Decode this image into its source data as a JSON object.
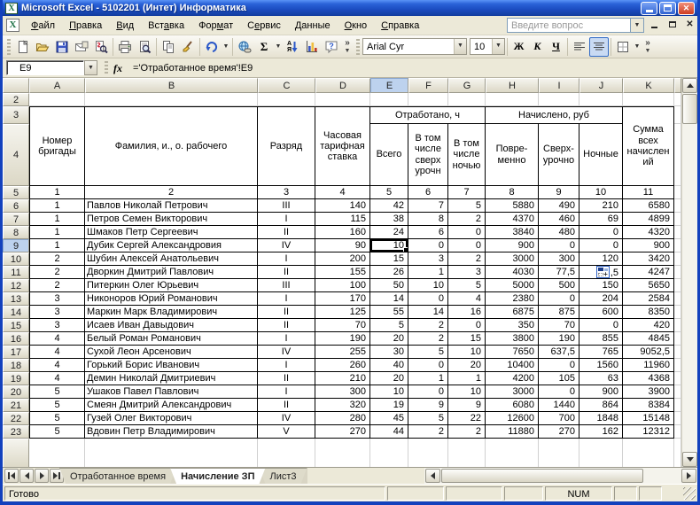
{
  "window": {
    "title": "Microsoft Excel - 5102201 (Интет) Информатика"
  },
  "menu": {
    "items": [
      {
        "label": "Файл",
        "underline": 0
      },
      {
        "label": "Правка",
        "underline": 0
      },
      {
        "label": "Вид",
        "underline": 0
      },
      {
        "label": "Вставка",
        "underline": 3
      },
      {
        "label": "Формат",
        "underline": 3
      },
      {
        "label": "Сервис",
        "underline": 1
      },
      {
        "label": "Данные",
        "underline": 0
      },
      {
        "label": "Окно",
        "underline": 0
      },
      {
        "label": "Справка",
        "underline": 0
      }
    ],
    "question_placeholder": "Введите вопрос"
  },
  "toolbar": {
    "font_name": "Arial Cyr",
    "font_size": "10",
    "bold_label": "Ж",
    "italic_label": "К",
    "underline_label": "Ч",
    "autosum_label": "Σ",
    "sort_top": "А",
    "sort_bottom": "Я",
    "help_label": "?"
  },
  "formula_bar": {
    "name_box": "E9",
    "fx_label": "fx",
    "formula": "='Отработанное время'!E9"
  },
  "sheet": {
    "columns": [
      "A",
      "B",
      "C",
      "D",
      "E",
      "F",
      "G",
      "H",
      "I",
      "J",
      "K"
    ],
    "selected_column": "E",
    "selected_row_header": 9,
    "active_cell": {
      "row": 9,
      "col_index": 4
    },
    "leading_row_numbers": [
      "2",
      "3",
      "4",
      "5"
    ],
    "header": {
      "brigade": "Номер бригады",
      "name": "Фамилия, и., о. рабочего",
      "razryad": "Разряд",
      "rate": "Часовая тарифная ставка",
      "worked_group": "Отработано, ч",
      "worked_total": "Всего",
      "worked_overtime": "В том числе сверх урочн",
      "worked_night": "В том числе ночью",
      "accrued_group": "Начислено, руб",
      "accrued_time": "Повре- менно",
      "accrued_overtime": "Сверх- урочно",
      "accrued_night": "Ночные",
      "total": "Сумма всех начислен ий"
    },
    "numbering_row": [
      "1",
      "2",
      "3",
      "4",
      "5",
      "6",
      "7",
      "8",
      "9",
      "10",
      "11"
    ],
    "rows": [
      {
        "n": 6,
        "c": [
          "1",
          "Павлов Николай Петрович",
          "III",
          "140",
          "42",
          "7",
          "5",
          "5880",
          "490",
          "210",
          "6580"
        ]
      },
      {
        "n": 7,
        "c": [
          "1",
          "Петров Семен Викторович",
          "I",
          "115",
          "38",
          "8",
          "2",
          "4370",
          "460",
          "69",
          "4899"
        ]
      },
      {
        "n": 8,
        "c": [
          "1",
          "Шмаков Петр Сергеевич",
          "II",
          "160",
          "24",
          "6",
          "0",
          "3840",
          "480",
          "0",
          "4320"
        ]
      },
      {
        "n": 9,
        "c": [
          "1",
          "Дубик Сергей Александровия",
          "IV",
          "90",
          "10",
          "0",
          "0",
          "900",
          "0",
          "0",
          "900"
        ]
      },
      {
        "n": 10,
        "c": [
          "2",
          "Шубин Алексей Анатольевич",
          "I",
          "200",
          "15",
          "3",
          "2",
          "3000",
          "300",
          "120",
          "3420"
        ]
      },
      {
        "n": 11,
        "c": [
          "2",
          "Дворкин Дмитрий Павлович",
          "II",
          "155",
          "26",
          "1",
          "3",
          "4030",
          "77,5",
          ",5",
          "4247"
        ]
      },
      {
        "n": 12,
        "c": [
          "2",
          "Питеркин Олег Юрьевич",
          "III",
          "100",
          "50",
          "10",
          "5",
          "5000",
          "500",
          "150",
          "5650"
        ]
      },
      {
        "n": 13,
        "c": [
          "3",
          "Никоноров Юрий Романович",
          "I",
          "170",
          "14",
          "0",
          "4",
          "2380",
          "0",
          "204",
          "2584"
        ]
      },
      {
        "n": 14,
        "c": [
          "3",
          "Маркин Марк Владимирович",
          "II",
          "125",
          "55",
          "14",
          "16",
          "6875",
          "875",
          "600",
          "8350"
        ]
      },
      {
        "n": 15,
        "c": [
          "3",
          "Исаев Иван Давыдович",
          "II",
          "70",
          "5",
          "2",
          "0",
          "350",
          "70",
          "0",
          "420"
        ]
      },
      {
        "n": 16,
        "c": [
          "4",
          "Белый Роман Романович",
          "I",
          "190",
          "20",
          "2",
          "15",
          "3800",
          "190",
          "855",
          "4845"
        ]
      },
      {
        "n": 17,
        "c": [
          "4",
          "Сухой Леон Арсенович",
          "IV",
          "255",
          "30",
          "5",
          "10",
          "7650",
          "637,5",
          "765",
          "9052,5"
        ]
      },
      {
        "n": 18,
        "c": [
          "4",
          "Горький Борис Иванович",
          "I",
          "260",
          "40",
          "0",
          "20",
          "10400",
          "0",
          "1560",
          "11960"
        ]
      },
      {
        "n": 19,
        "c": [
          "4",
          "Демин Николай Дмитриевич",
          "II",
          "210",
          "20",
          "1",
          "1",
          "4200",
          "105",
          "63",
          "4368"
        ]
      },
      {
        "n": 20,
        "c": [
          "5",
          "Ушаков Павел Павлович",
          "I",
          "300",
          "10",
          "0",
          "10",
          "3000",
          "0",
          "900",
          "3900"
        ]
      },
      {
        "n": 21,
        "c": [
          "5",
          "Смеян Дмитрий Александрович",
          "II",
          "320",
          "19",
          "9",
          "9",
          "6080",
          "1440",
          "864",
          "8384"
        ]
      },
      {
        "n": 22,
        "c": [
          "5",
          "Гузей Олег Викторович",
          "IV",
          "280",
          "45",
          "5",
          "22",
          "12600",
          "700",
          "1848",
          "15148"
        ]
      },
      {
        "n": 23,
        "c": [
          "5",
          "Вдовин Петр Владимирович",
          "V",
          "270",
          "44",
          "2",
          "2",
          "11880",
          "270",
          "162",
          "12312"
        ]
      }
    ],
    "smart_tag_cell": {
      "row": 11,
      "col_index": 9
    }
  },
  "tabs": {
    "items": [
      {
        "label": "Отработанное время",
        "active": false
      },
      {
        "label": "Начисление ЗП",
        "active": true
      },
      {
        "label": "Лист3",
        "active": false
      }
    ]
  },
  "status": {
    "left": "Готово",
    "num": "NUM"
  }
}
